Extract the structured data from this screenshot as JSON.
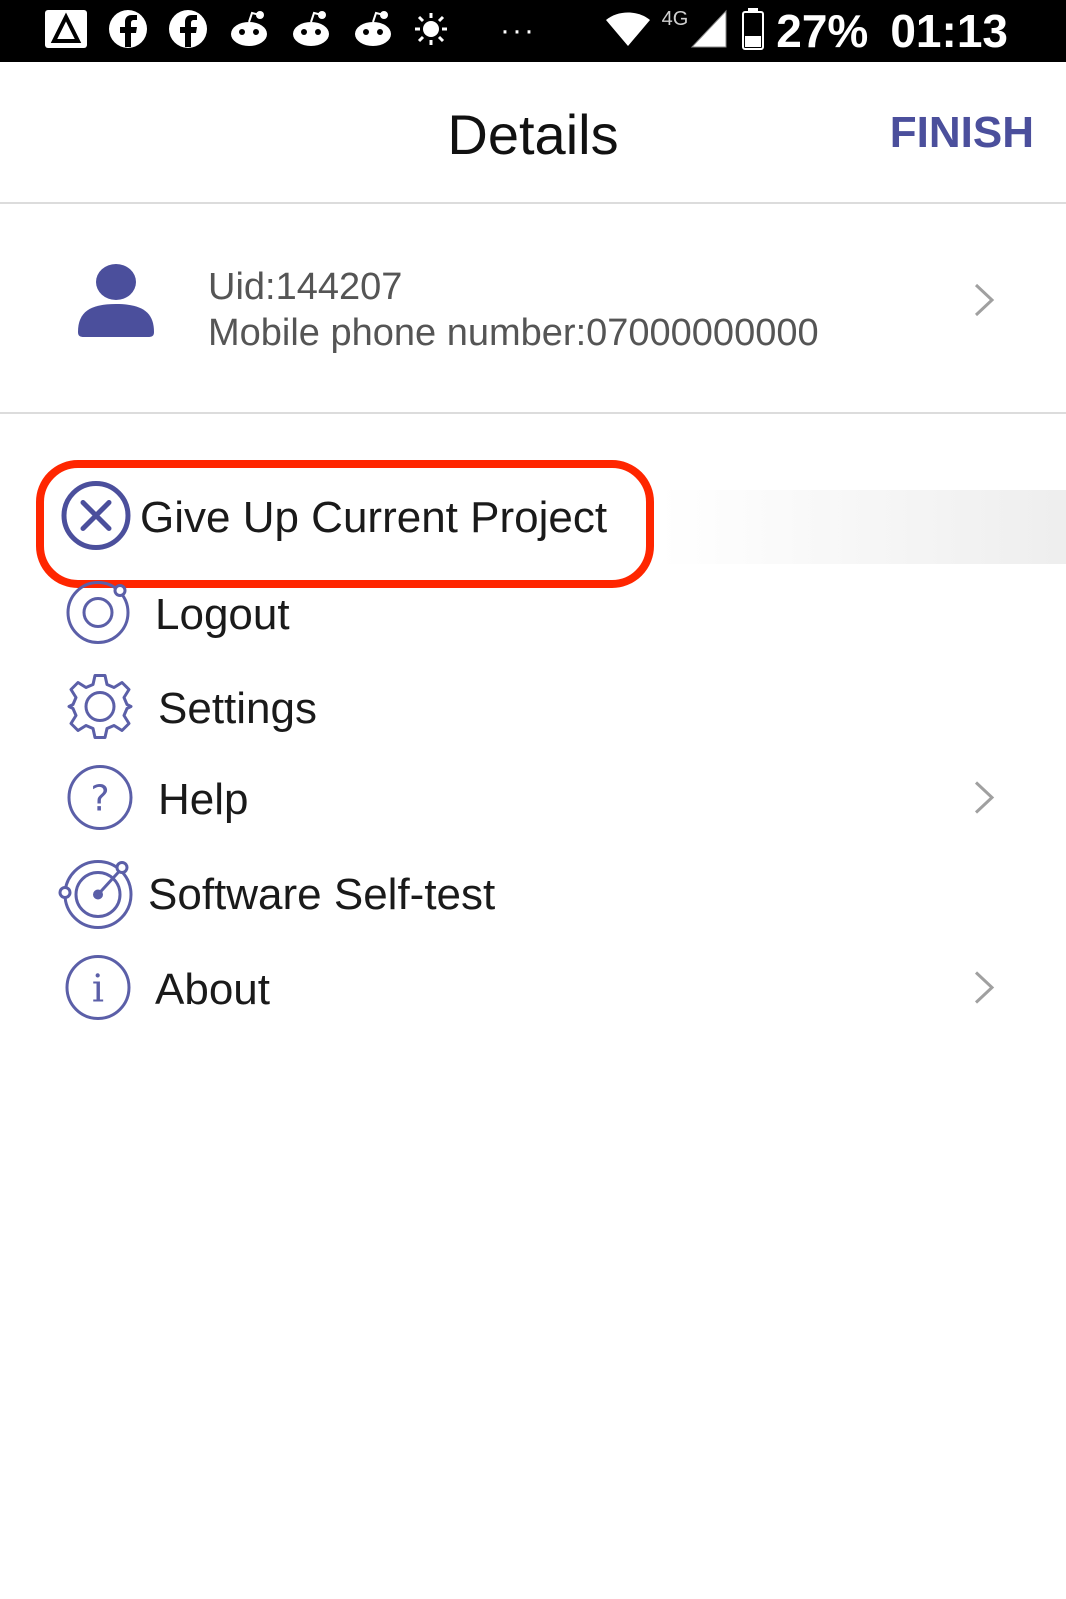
{
  "status_bar": {
    "network": "4G",
    "battery": "27%",
    "time": "01:13",
    "notification_icons": [
      "warning-icon",
      "facebook-icon",
      "facebook-icon",
      "reddit-icon",
      "reddit-icon",
      "reddit-icon",
      "brightness-icon"
    ],
    "more_indicator": "···"
  },
  "header": {
    "title": "Details",
    "finish_label": "FINISH"
  },
  "user": {
    "uid": "Uid:144207",
    "phone": "Mobile phone number:07000000000",
    "avatar_icon": "person-icon",
    "chevron_icon": "chevron-right-icon"
  },
  "menu": {
    "items": [
      {
        "label": "Give Up Current Project",
        "icon": "cancel-icon",
        "chevron": false
      },
      {
        "label": "Logout",
        "icon": "logout-icon",
        "chevron": false
      },
      {
        "label": "Settings",
        "icon": "gear-icon",
        "chevron": false
      },
      {
        "label": "Help",
        "icon": "help-icon",
        "chevron": true
      },
      {
        "label": "Software Self-test",
        "icon": "radar-icon",
        "chevron": false
      },
      {
        "label": "About",
        "icon": "info-icon",
        "chevron": true
      }
    ]
  },
  "colors": {
    "accent": "#4b4f9c",
    "highlight": "#ff2600",
    "icon": "#5b5fa8"
  }
}
